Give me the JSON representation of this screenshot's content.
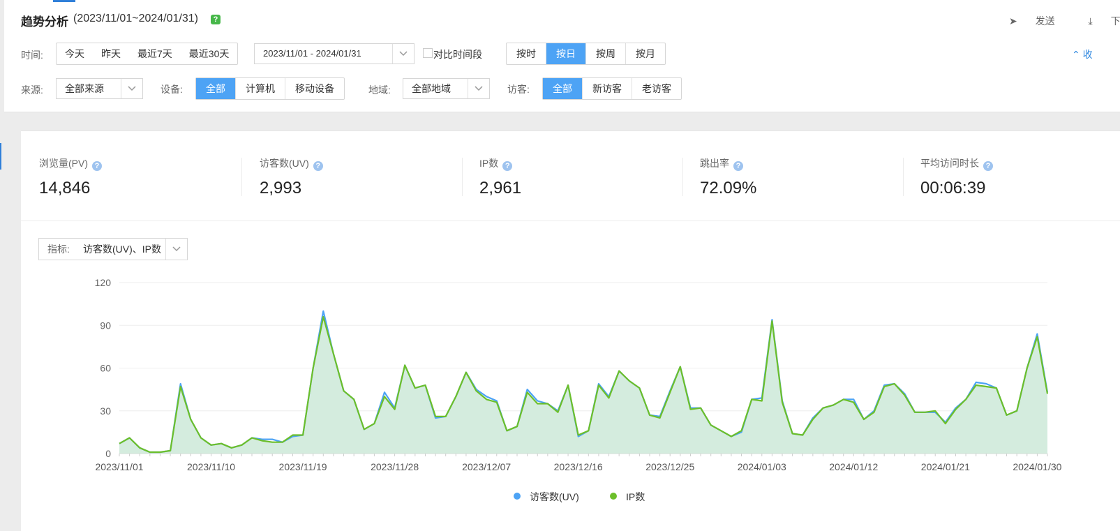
{
  "header": {
    "title": "趋势分析",
    "date_range": "(2023/11/01~2024/01/31)",
    "help": "?",
    "actions": {
      "send": "发送",
      "download": "下载"
    },
    "collapse": "收"
  },
  "filters": {
    "time": {
      "label": "时间:",
      "quick": [
        "今天",
        "昨天",
        "最近7天",
        "最近30天"
      ],
      "range_value": "2023/11/01 - 2024/01/31",
      "compare_label": "对比时间段",
      "granularity": [
        "按时",
        "按日",
        "按周",
        "按月"
      ],
      "granularity_active": "按日"
    },
    "source": {
      "label": "来源:",
      "value": "全部来源"
    },
    "device": {
      "label": "设备:",
      "options": [
        "全部",
        "计算机",
        "移动设备"
      ],
      "active": "全部"
    },
    "region": {
      "label": "地域:",
      "value": "全部地域"
    },
    "visitor": {
      "label": "访客:",
      "options": [
        "全部",
        "新访客",
        "老访客"
      ],
      "active": "全部"
    }
  },
  "metrics": [
    {
      "label": "浏览量(PV)",
      "value": "14,846"
    },
    {
      "label": "访客数(UV)",
      "value": "2,993"
    },
    {
      "label": "IP数",
      "value": "2,961"
    },
    {
      "label": "跳出率",
      "value": "72.09%"
    },
    {
      "label": "平均访问时长",
      "value": "00:06:39"
    }
  ],
  "indicator": {
    "label": "指标:",
    "value": "访客数(UV)、IP数"
  },
  "colors": {
    "uv": "#4da3f5",
    "ip": "#6cbf2a",
    "active": "#4da3f5",
    "area": "#d2ebdc"
  },
  "chart_data": {
    "type": "line",
    "x": [
      "2023/11/01",
      "2023/11/02",
      "2023/11/03",
      "2023/11/04",
      "2023/11/05",
      "2023/11/06",
      "2023/11/07",
      "2023/11/08",
      "2023/11/09",
      "2023/11/10",
      "2023/11/11",
      "2023/11/12",
      "2023/11/13",
      "2023/11/14",
      "2023/11/15",
      "2023/11/16",
      "2023/11/17",
      "2023/11/18",
      "2023/11/19",
      "2023/11/20",
      "2023/11/21",
      "2023/11/22",
      "2023/11/23",
      "2023/11/24",
      "2023/11/25",
      "2023/11/26",
      "2023/11/27",
      "2023/11/28",
      "2023/11/29",
      "2023/11/30",
      "2023/12/01",
      "2023/12/02",
      "2023/12/03",
      "2023/12/04",
      "2023/12/05",
      "2023/12/06",
      "2023/12/07",
      "2023/12/08",
      "2023/12/09",
      "2023/12/10",
      "2023/12/11",
      "2023/12/12",
      "2023/12/13",
      "2023/12/14",
      "2023/12/15",
      "2023/12/16",
      "2023/12/17",
      "2023/12/18",
      "2023/12/19",
      "2023/12/20",
      "2023/12/21",
      "2023/12/22",
      "2023/12/23",
      "2023/12/24",
      "2023/12/25",
      "2023/12/26",
      "2023/12/27",
      "2023/12/28",
      "2023/12/29",
      "2023/12/30",
      "2023/12/31",
      "2024/01/01",
      "2024/01/02",
      "2024/01/03",
      "2024/01/04",
      "2024/01/05",
      "2024/01/06",
      "2024/01/07",
      "2024/01/08",
      "2024/01/09",
      "2024/01/10",
      "2024/01/11",
      "2024/01/12",
      "2024/01/13",
      "2024/01/14",
      "2024/01/15",
      "2024/01/16",
      "2024/01/17",
      "2024/01/18",
      "2024/01/19",
      "2024/01/20",
      "2024/01/21",
      "2024/01/22",
      "2024/01/23",
      "2024/01/24",
      "2024/01/25",
      "2024/01/26",
      "2024/01/27",
      "2024/01/28",
      "2024/01/29",
      "2024/01/30",
      "2024/01/31"
    ],
    "tick_labels": [
      "2023/11/01",
      "2023/11/10",
      "2023/11/19",
      "2023/11/28",
      "2023/12/07",
      "2023/12/16",
      "2023/12/25",
      "2024/01/03",
      "2024/01/12",
      "2024/01/21",
      "2024/01/30"
    ],
    "ylim": [
      0,
      120
    ],
    "yticks": [
      0,
      30,
      60,
      90,
      120
    ],
    "grid": true,
    "legend": "bottom-center",
    "series": [
      {
        "name": "访客数(UV)",
        "values": [
          7,
          11,
          4,
          1,
          1,
          2,
          49,
          24,
          11,
          6,
          7,
          4,
          6,
          11,
          10,
          10,
          8,
          12,
          13,
          60,
          100,
          70,
          44,
          38,
          17,
          21,
          43,
          32,
          62,
          46,
          48,
          25,
          26,
          40,
          57,
          45,
          40,
          37,
          16,
          19,
          45,
          37,
          35,
          30,
          48,
          12,
          16,
          49,
          40,
          58,
          51,
          46,
          27,
          26,
          44,
          61,
          32,
          32,
          20,
          16,
          12,
          15,
          38,
          39,
          94,
          37,
          14,
          13,
          25,
          32,
          34,
          38,
          38,
          24,
          30,
          48,
          49,
          42,
          29,
          29,
          29,
          22,
          32,
          38,
          50,
          49,
          46,
          27,
          30,
          60,
          84,
          43
        ]
      },
      {
        "name": "IP数",
        "values": [
          7,
          11,
          4,
          1,
          1,
          2,
          47,
          24,
          11,
          6,
          7,
          4,
          6,
          11,
          9,
          8,
          8,
          13,
          13,
          60,
          96,
          70,
          44,
          38,
          17,
          21,
          40,
          31,
          62,
          46,
          48,
          26,
          26,
          40,
          57,
          44,
          38,
          36,
          16,
          19,
          43,
          35,
          35,
          29,
          48,
          13,
          16,
          48,
          39,
          58,
          51,
          46,
          27,
          25,
          43,
          61,
          31,
          32,
          20,
          16,
          12,
          16,
          38,
          37,
          93,
          36,
          14,
          13,
          24,
          32,
          34,
          38,
          36,
          24,
          29,
          47,
          49,
          41,
          29,
          29,
          30,
          21,
          31,
          38,
          48,
          47,
          46,
          27,
          30,
          60,
          82,
          42
        ]
      }
    ]
  }
}
